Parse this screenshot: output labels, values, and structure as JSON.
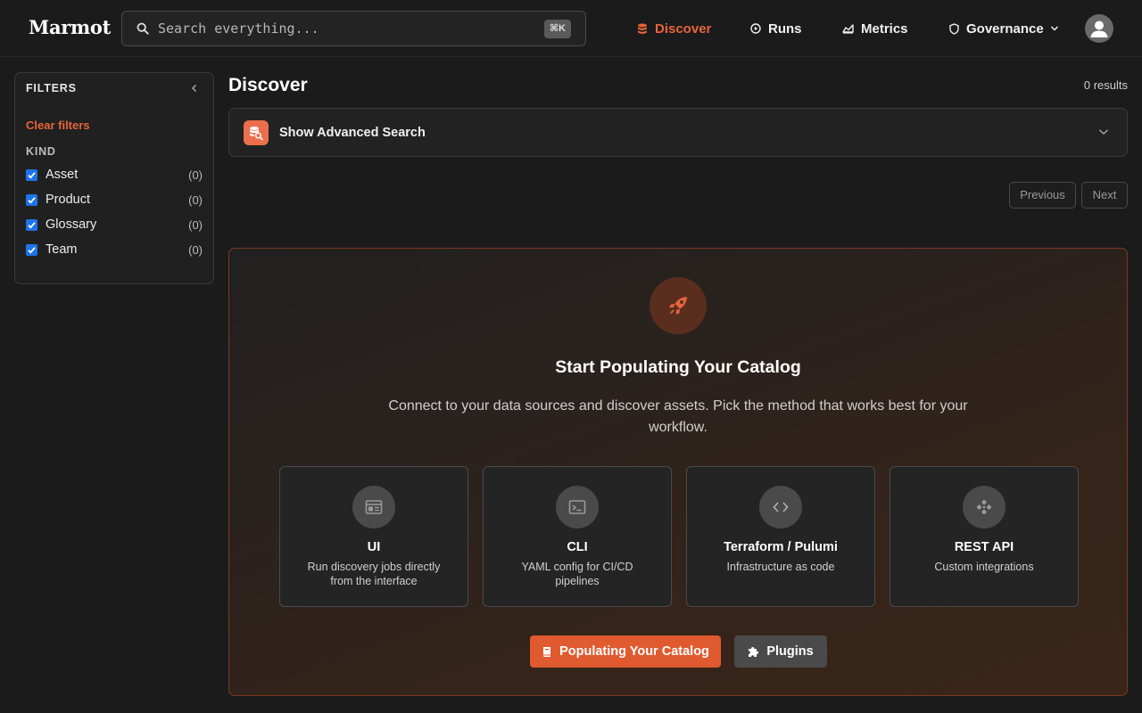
{
  "app": {
    "logo": "Marmot"
  },
  "search": {
    "placeholder": "Search everything...",
    "shortcut": "⌘K"
  },
  "nav": {
    "items": [
      {
        "label": "Discover",
        "icon": "database-icon",
        "active": true
      },
      {
        "label": "Runs",
        "icon": "play-circle-icon",
        "active": false
      },
      {
        "label": "Metrics",
        "icon": "chart-area-icon",
        "active": false
      },
      {
        "label": "Governance",
        "icon": "shield-icon",
        "active": false
      }
    ]
  },
  "filters": {
    "title": "FILTERS",
    "clear_label": "Clear filters",
    "kind_label": "KIND",
    "kinds": [
      {
        "label": "Asset",
        "count": "(0)",
        "checked": true
      },
      {
        "label": "Product",
        "count": "(0)",
        "checked": true
      },
      {
        "label": "Glossary",
        "count": "(0)",
        "checked": true
      },
      {
        "label": "Team",
        "count": "(0)",
        "checked": true
      }
    ]
  },
  "main": {
    "title": "Discover",
    "results": "0 results",
    "advanced_search_label": "Show Advanced Search",
    "pagination": {
      "previous": "Previous",
      "next": "Next"
    }
  },
  "hero": {
    "title": "Start Populating Your Catalog",
    "subtitle": "Connect to your data sources and discover assets. Pick the method that works best for your workflow.",
    "cards": [
      {
        "title": "UI",
        "description": "Run discovery jobs directly from the interface",
        "icon": "browser-window-icon"
      },
      {
        "title": "CLI",
        "description": "YAML config for CI/CD pipelines",
        "icon": "terminal-icon"
      },
      {
        "title": "Terraform / Pulumi",
        "description": "Infrastructure as code",
        "icon": "code-brackets-icon"
      },
      {
        "title": "REST API",
        "description": "Custom integrations",
        "icon": "api-nodes-icon"
      }
    ],
    "primary_button": "Populating Your Catalog",
    "secondary_button": "Plugins"
  },
  "colors": {
    "accent": "#e8643a",
    "background": "#1b1b1b",
    "checkbox": "#1d74e8"
  }
}
